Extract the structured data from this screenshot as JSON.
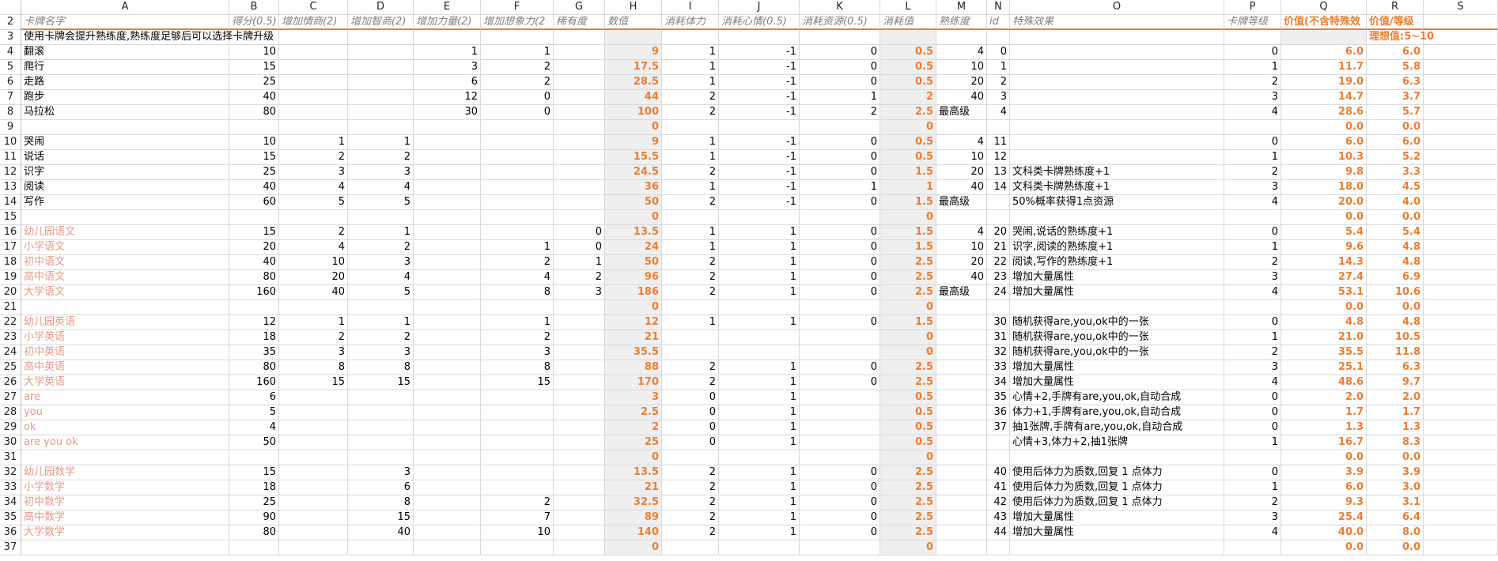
{
  "colors": {
    "accent": "#ed7d31",
    "salmon": "#e59a8a",
    "header_gray": "#7f7f7f",
    "calc_fill": "#efefef"
  },
  "column_letters": [
    "A",
    "B",
    "C",
    "D",
    "E",
    "F",
    "G",
    "H",
    "I",
    "J",
    "K",
    "L",
    "M",
    "N",
    "O",
    "P",
    "Q",
    "R",
    "S"
  ],
  "rows": [
    {
      "n": "2",
      "cells": [
        "卡牌名字",
        "得分(0.5)",
        "增加情商(2)",
        "增加智商(2)",
        "增加力量(2)",
        "增加想象力(2",
        "稀有度",
        "数值",
        "消耗体力",
        "消耗心情(0.5)",
        "消耗资源(0.5)",
        "消耗值",
        "熟练度",
        "id",
        "特殊效果",
        "卡牌等级",
        "价值(不含特殊效",
        "价值/等级",
        ""
      ]
    },
    {
      "n": "3",
      "cells": [
        "使用卡牌会提升熟练度,熟练度足够后可以选择卡牌升级",
        "",
        "",
        "",
        "",
        "",
        "",
        "",
        "",
        "",
        "",
        "",
        "",
        "",
        "",
        "",
        "",
        "理想值:5~10",
        ""
      ]
    },
    {
      "n": "4",
      "cells": [
        "翻滚",
        "10",
        "",
        "",
        "1",
        "1",
        "",
        "9",
        "1",
        "-1",
        "0",
        "0.5",
        "4",
        "0",
        "",
        "0",
        "6.0",
        "6.0",
        ""
      ]
    },
    {
      "n": "5",
      "cells": [
        "爬行",
        "15",
        "",
        "",
        "3",
        "2",
        "",
        "17.5",
        "1",
        "-1",
        "0",
        "0.5",
        "10",
        "1",
        "",
        "1",
        "11.7",
        "5.8",
        ""
      ]
    },
    {
      "n": "6",
      "cells": [
        "走路",
        "25",
        "",
        "",
        "6",
        "2",
        "",
        "28.5",
        "1",
        "-1",
        "0",
        "0.5",
        "20",
        "2",
        "",
        "2",
        "19.0",
        "6.3",
        ""
      ]
    },
    {
      "n": "7",
      "cells": [
        "跑步",
        "40",
        "",
        "",
        "12",
        "0",
        "",
        "44",
        "2",
        "-1",
        "1",
        "2",
        "40",
        "3",
        "",
        "3",
        "14.7",
        "3.7",
        ""
      ]
    },
    {
      "n": "8",
      "cells": [
        "马拉松",
        "80",
        "",
        "",
        "30",
        "0",
        "",
        "100",
        "2",
        "-1",
        "2",
        "2.5",
        "最高级",
        "4",
        "",
        "4",
        "28.6",
        "5.7",
        ""
      ]
    },
    {
      "n": "9",
      "cells": [
        "",
        "",
        "",
        "",
        "",
        "",
        "",
        "0",
        "",
        "",
        "",
        "0",
        "",
        "",
        "",
        "",
        "0.0",
        "0.0",
        ""
      ]
    },
    {
      "n": "10",
      "cells": [
        "哭闹",
        "10",
        "1",
        "1",
        "",
        "",
        "",
        "9",
        "1",
        "-1",
        "0",
        "0.5",
        "4",
        "11",
        "",
        "0",
        "6.0",
        "6.0",
        ""
      ]
    },
    {
      "n": "11",
      "cells": [
        "说话",
        "15",
        "2",
        "2",
        "",
        "",
        "",
        "15.5",
        "1",
        "-1",
        "0",
        "0.5",
        "10",
        "12",
        "",
        "1",
        "10.3",
        "5.2",
        ""
      ]
    },
    {
      "n": "12",
      "cells": [
        "识字",
        "25",
        "3",
        "3",
        "",
        "",
        "",
        "24.5",
        "2",
        "-1",
        "0",
        "1.5",
        "20",
        "13",
        "文科类卡牌熟练度+1",
        "2",
        "9.8",
        "3.3",
        ""
      ]
    },
    {
      "n": "13",
      "cells": [
        "阅读",
        "40",
        "4",
        "4",
        "",
        "",
        "",
        "36",
        "1",
        "-1",
        "1",
        "1",
        "40",
        "14",
        "文科类卡牌熟练度+1",
        "3",
        "18.0",
        "4.5",
        ""
      ]
    },
    {
      "n": "14",
      "cells": [
        "写作",
        "60",
        "5",
        "5",
        "",
        "",
        "",
        "50",
        "2",
        "-1",
        "0",
        "1.5",
        "最高级",
        "",
        "50%概率获得1点资源",
        "4",
        "20.0",
        "4.0",
        ""
      ]
    },
    {
      "n": "15",
      "cells": [
        "",
        "",
        "",
        "",
        "",
        "",
        "",
        "0",
        "",
        "",
        "",
        "0",
        "",
        "",
        "",
        "",
        "0.0",
        "0.0",
        ""
      ]
    },
    {
      "n": "16",
      "cells": [
        "幼儿园语文",
        "15",
        "2",
        "1",
        "",
        "",
        "0",
        "13.5",
        "1",
        "1",
        "0",
        "1.5",
        "4",
        "20",
        "哭闹,说话的熟练度+1",
        "0",
        "5.4",
        "5.4",
        ""
      ]
    },
    {
      "n": "17",
      "cells": [
        "小学语文",
        "20",
        "4",
        "2",
        "",
        "1",
        "0",
        "24",
        "1",
        "1",
        "0",
        "1.5",
        "10",
        "21",
        "识字,阅读的熟练度+1",
        "1",
        "9.6",
        "4.8",
        ""
      ]
    },
    {
      "n": "18",
      "cells": [
        "初中语文",
        "40",
        "10",
        "3",
        "",
        "2",
        "1",
        "50",
        "2",
        "1",
        "0",
        "2.5",
        "20",
        "22",
        "阅读,写作的熟练度+1",
        "2",
        "14.3",
        "4.8",
        ""
      ]
    },
    {
      "n": "19",
      "cells": [
        "高中语文",
        "80",
        "20",
        "4",
        "",
        "4",
        "2",
        "96",
        "2",
        "1",
        "0",
        "2.5",
        "40",
        "23",
        "增加大量属性",
        "3",
        "27.4",
        "6.9",
        ""
      ]
    },
    {
      "n": "20",
      "cells": [
        "大学语文",
        "160",
        "40",
        "5",
        "",
        "8",
        "3",
        "186",
        "2",
        "1",
        "0",
        "2.5",
        "最高级",
        "24",
        "增加大量属性",
        "4",
        "53.1",
        "10.6",
        ""
      ]
    },
    {
      "n": "21",
      "cells": [
        "",
        "",
        "",
        "",
        "",
        "",
        "",
        "0",
        "",
        "",
        "",
        "0",
        "",
        "",
        "",
        "",
        "0.0",
        "0.0",
        ""
      ]
    },
    {
      "n": "22",
      "cells": [
        "幼儿园英语",
        "12",
        "1",
        "1",
        "",
        "1",
        "",
        "12",
        "1",
        "1",
        "0",
        "1.5",
        "",
        "30",
        "随机获得are,you,ok中的一张",
        "0",
        "4.8",
        "4.8",
        ""
      ]
    },
    {
      "n": "23",
      "cells": [
        "小学英语",
        "18",
        "2",
        "2",
        "",
        "2",
        "",
        "21",
        "",
        "",
        "",
        "0",
        "",
        "31",
        "随机获得are,you,ok中的一张",
        "1",
        "21.0",
        "10.5",
        ""
      ]
    },
    {
      "n": "24",
      "cells": [
        "初中英语",
        "35",
        "3",
        "3",
        "",
        "3",
        "",
        "35.5",
        "",
        "",
        "",
        "0",
        "",
        "32",
        "随机获得are,you,ok中的一张",
        "2",
        "35.5",
        "11.8",
        ""
      ]
    },
    {
      "n": "25",
      "cells": [
        "高中英语",
        "80",
        "8",
        "8",
        "",
        "8",
        "",
        "88",
        "2",
        "1",
        "0",
        "2.5",
        "",
        "33",
        "增加大量属性",
        "3",
        "25.1",
        "6.3",
        ""
      ]
    },
    {
      "n": "26",
      "cells": [
        "大学英语",
        "160",
        "15",
        "15",
        "",
        "15",
        "",
        "170",
        "2",
        "1",
        "0",
        "2.5",
        "",
        "34",
        "增加大量属性",
        "4",
        "48.6",
        "9.7",
        ""
      ]
    },
    {
      "n": "27",
      "cells": [
        "are",
        "6",
        "",
        "",
        "",
        "",
        "",
        "3",
        "0",
        "1",
        "",
        "0.5",
        "",
        "35",
        "心情+2,手牌有are,you,ok,自动合成",
        "0",
        "2.0",
        "2.0",
        ""
      ]
    },
    {
      "n": "28",
      "cells": [
        "you",
        "5",
        "",
        "",
        "",
        "",
        "",
        "2.5",
        "0",
        "1",
        "",
        "0.5",
        "",
        "36",
        "体力+1,手牌有are,you,ok,自动合成",
        "0",
        "1.7",
        "1.7",
        ""
      ]
    },
    {
      "n": "29",
      "cells": [
        "ok",
        "4",
        "",
        "",
        "",
        "",
        "",
        "2",
        "0",
        "1",
        "",
        "0.5",
        "",
        "37",
        "抽1张牌,手牌有are,you,ok,自动合成",
        "0",
        "1.3",
        "1.3",
        ""
      ]
    },
    {
      "n": "30",
      "cells": [
        "are you ok",
        "50",
        "",
        "",
        "",
        "",
        "",
        "25",
        "0",
        "1",
        "",
        "0.5",
        "",
        "",
        "心情+3,体力+2,抽1张牌",
        "1",
        "16.7",
        "8.3",
        ""
      ]
    },
    {
      "n": "31",
      "cells": [
        "",
        "",
        "",
        "",
        "",
        "",
        "",
        "0",
        "",
        "",
        "",
        "0",
        "",
        "",
        "",
        "",
        "0.0",
        "0.0",
        ""
      ]
    },
    {
      "n": "32",
      "cells": [
        "幼儿园数学",
        "15",
        "",
        "3",
        "",
        "",
        "",
        "13.5",
        "2",
        "1",
        "0",
        "2.5",
        "",
        "40",
        "使用后体力为质数,回复 1 点体力",
        "0",
        "3.9",
        "3.9",
        ""
      ]
    },
    {
      "n": "33",
      "cells": [
        "小学数学",
        "18",
        "",
        "6",
        "",
        "",
        "",
        "21",
        "2",
        "1",
        "0",
        "2.5",
        "",
        "41",
        "使用后体力为质数,回复 1 点体力",
        "1",
        "6.0",
        "3.0",
        ""
      ]
    },
    {
      "n": "34",
      "cells": [
        "初中数学",
        "25",
        "",
        "8",
        "",
        "2",
        "",
        "32.5",
        "2",
        "1",
        "0",
        "2.5",
        "",
        "42",
        "使用后体力为质数,回复 1 点体力",
        "2",
        "9.3",
        "3.1",
        ""
      ]
    },
    {
      "n": "35",
      "cells": [
        "高中数学",
        "90",
        "",
        "15",
        "",
        "7",
        "",
        "89",
        "2",
        "1",
        "0",
        "2.5",
        "",
        "43",
        "增加大量属性",
        "3",
        "25.4",
        "6.4",
        ""
      ]
    },
    {
      "n": "36",
      "cells": [
        "大学数学",
        "80",
        "",
        "40",
        "",
        "10",
        "",
        "140",
        "2",
        "1",
        "0",
        "2.5",
        "",
        "44",
        "增加大量属性",
        "4",
        "40.0",
        "8.0",
        ""
      ]
    },
    {
      "n": "37",
      "cells": [
        "",
        "",
        "",
        "",
        "",
        "",
        "",
        "0",
        "",
        "",
        "",
        "0",
        "",
        "",
        "",
        "",
        "0.0",
        "0.0",
        ""
      ]
    }
  ]
}
